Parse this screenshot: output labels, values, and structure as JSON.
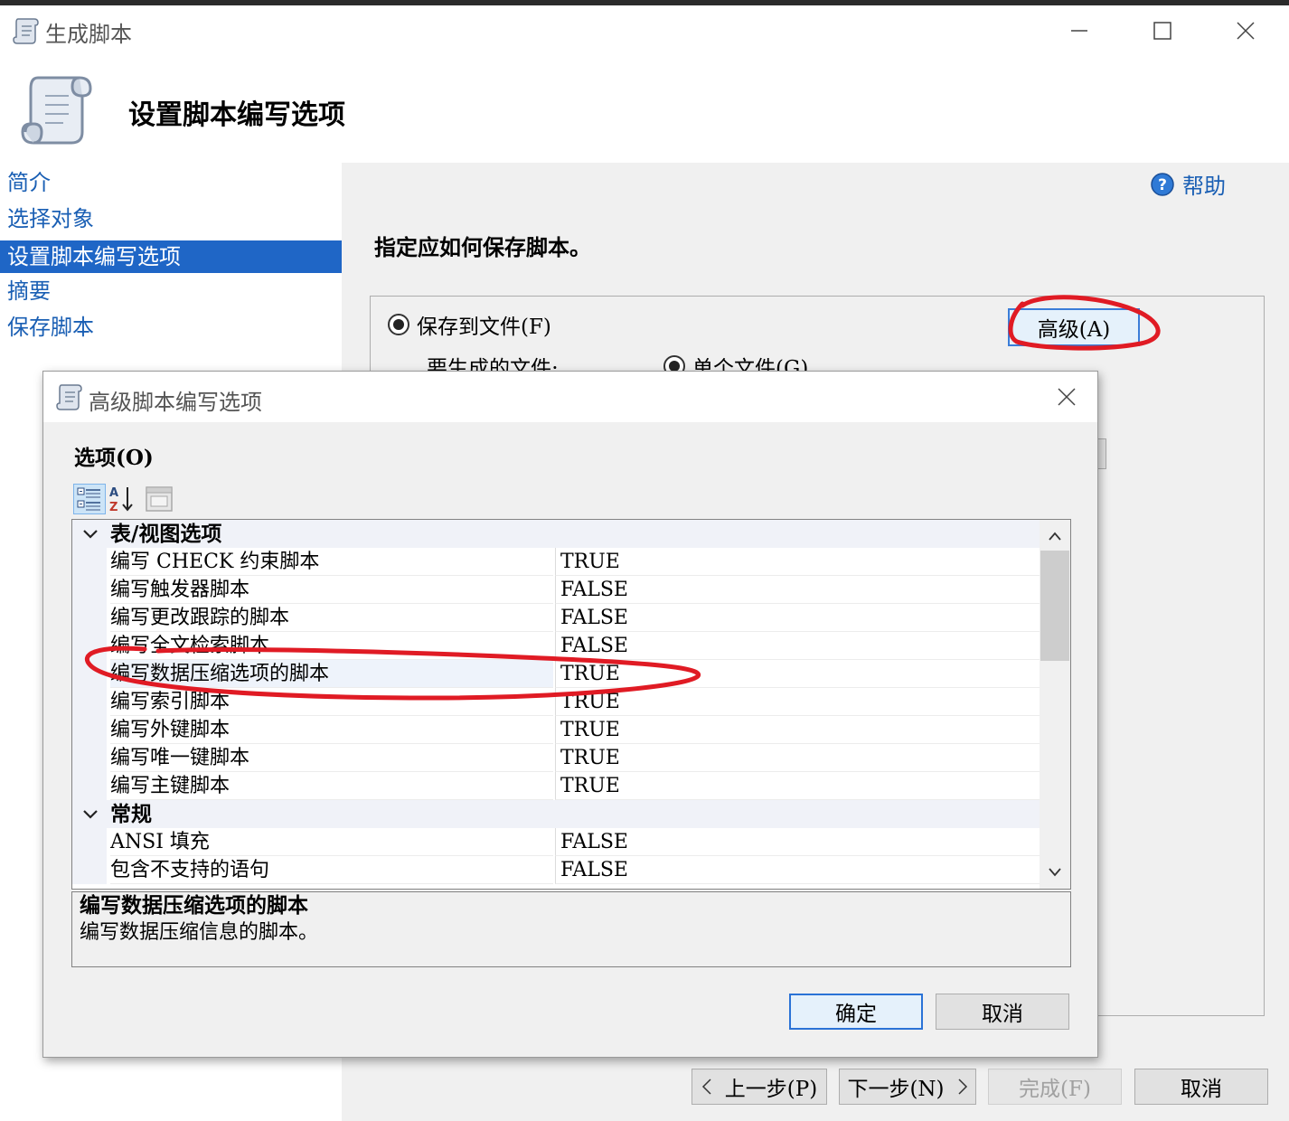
{
  "window": {
    "title": "生成脚本"
  },
  "header": {
    "title": "设置脚本编写选项"
  },
  "sidebar": {
    "items": [
      {
        "label": "简介",
        "active": false
      },
      {
        "label": "选择对象",
        "active": false
      },
      {
        "label": "设置脚本编写选项",
        "active": true
      },
      {
        "label": "摘要",
        "active": false
      },
      {
        "label": "保存脚本",
        "active": false
      }
    ]
  },
  "main": {
    "help_label": "帮助",
    "instruction": "指定应如何保存脚本。",
    "save_to_file_label": "保存到文件(F)",
    "advanced_label": "高级(A)",
    "files_label": "要生成的文件:",
    "single_file_label": "单个文件(G)"
  },
  "dialog": {
    "title": "高级脚本编写选项",
    "options_label": "选项(O)",
    "categories": [
      {
        "label": "表/视图选项",
        "rows": [
          {
            "name": "编写 CHECK 约束脚本",
            "value": "TRUE"
          },
          {
            "name": "编写触发器脚本",
            "value": "FALSE"
          },
          {
            "name": "编写更改跟踪的脚本",
            "value": "FALSE"
          },
          {
            "name": "编写全文检索脚本",
            "value": "FALSE"
          },
          {
            "name": "编写数据压缩选项的脚本",
            "value": "TRUE"
          },
          {
            "name": "编写索引脚本",
            "value": "TRUE"
          },
          {
            "name": "编写外键脚本",
            "value": "TRUE"
          },
          {
            "name": "编写唯一键脚本",
            "value": "TRUE"
          },
          {
            "name": "编写主键脚本",
            "value": "TRUE"
          }
        ]
      },
      {
        "label": "常规",
        "rows": [
          {
            "name": "ANSI 填充",
            "value": "FALSE"
          },
          {
            "name": "包含不支持的语句",
            "value": "FALSE"
          }
        ]
      }
    ],
    "description": {
      "title": "编写数据压缩选项的脚本",
      "text": "编写数据压缩信息的脚本。"
    },
    "ok_label": "确定",
    "cancel_label": "取消"
  },
  "footer": {
    "prev_label": "上一步(P)",
    "next_label": "下一步(N)",
    "finish_label": "完成(F)",
    "cancel_label": "取消"
  },
  "colors": {
    "accent": "#1f66c6",
    "link": "#1a5fb4",
    "annotation": "#e01b24"
  },
  "icons": [
    "script-icon",
    "minimize-icon",
    "maximize-icon",
    "close-icon",
    "help-icon",
    "categorized-icon",
    "sort-az-icon",
    "property-pages-icon",
    "chevron-down-icon",
    "chevron-up-icon",
    "chevron-left-icon",
    "chevron-right-icon"
  ]
}
